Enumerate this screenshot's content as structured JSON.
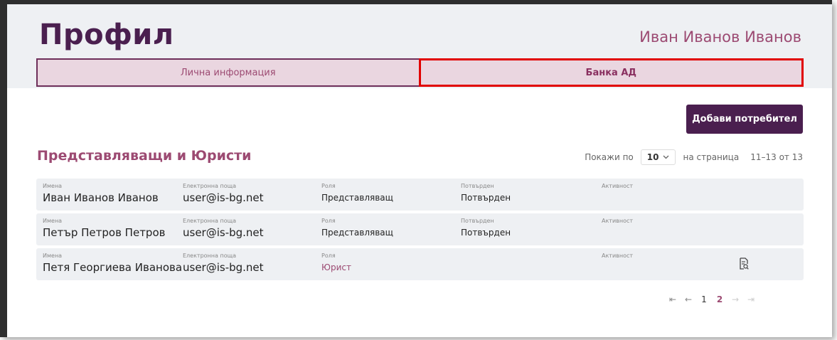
{
  "header": {
    "title": "Профил",
    "user_name": "Иван Иванов Иванов"
  },
  "tabs": [
    {
      "label": "Лична информация",
      "active": false
    },
    {
      "label": "Банка АД",
      "active": true
    }
  ],
  "actions": {
    "add_user_label": "Добави потребител"
  },
  "section": {
    "title": "Представляващи и Юристи"
  },
  "page_size": {
    "prefix": "Покажи по",
    "value": "10",
    "suffix": "на страница",
    "range": "11–13 от 13"
  },
  "columns": {
    "name": "Имена",
    "email": "Електронна поща",
    "role": "Роля",
    "confirmed": "Потвърден",
    "activity": "Активност"
  },
  "rows": [
    {
      "name": "Иван Иванов Иванов",
      "email": "user@is-bg.net",
      "role": "Представляващ",
      "confirmed": "Потвърден"
    },
    {
      "name": "Петър Петров Петров",
      "email": "user@is-bg.net",
      "role": "Представляващ",
      "confirmed": "Потвърден"
    },
    {
      "name": "Петя Георгиева Иванова",
      "email": "user@is-bg.net",
      "role": "Юрист",
      "confirmed": ""
    }
  ],
  "pagination": {
    "first": "⇤",
    "prev": "←",
    "pages": [
      "1",
      "2"
    ],
    "next": "→",
    "last": "⇥"
  },
  "colors": {
    "primary": "#4a1f4f",
    "accent": "#9c4a72",
    "tab_bg": "#ead6e0",
    "highlight": "#e10000"
  },
  "icons": {
    "row_action": "document-search-icon"
  }
}
